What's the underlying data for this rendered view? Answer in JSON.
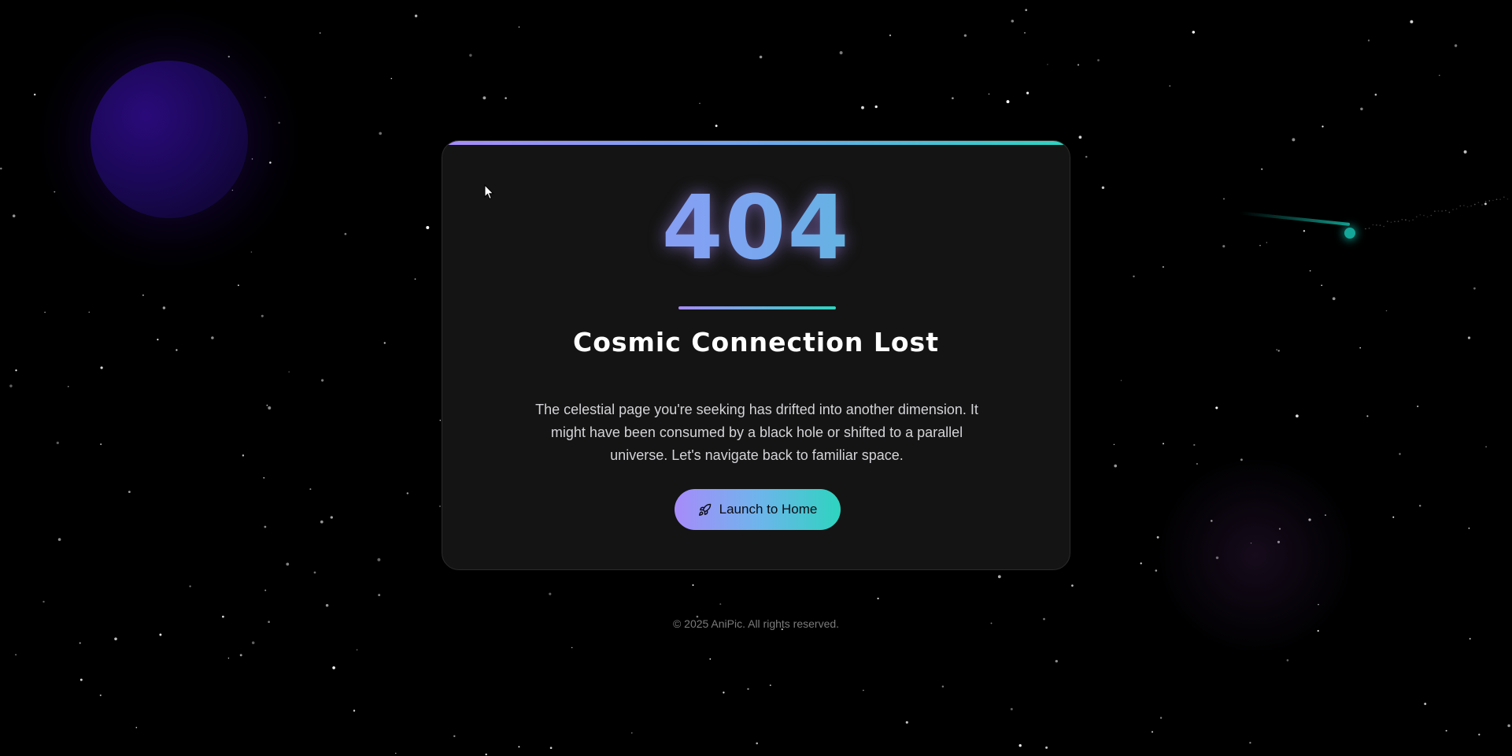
{
  "error": {
    "code": "404",
    "title": "Cosmic Connection Lost",
    "message": "The celestial page you're seeking has drifted into another dimension. It might have been consumed by a black hole or shifted to a parallel universe. Let's navigate back to familiar space."
  },
  "actions": {
    "home_button_label": "Launch to Home",
    "home_button_icon": "rocket-icon"
  },
  "footer": {
    "copyright": "© 2025 AniPic. All rights reserved."
  },
  "colors": {
    "background": "#000000",
    "card": "#141414",
    "gradient_start": "#a78bfa",
    "gradient_end": "#2dd4bf",
    "planet": "#1b0858",
    "comet": "#14a89a"
  }
}
